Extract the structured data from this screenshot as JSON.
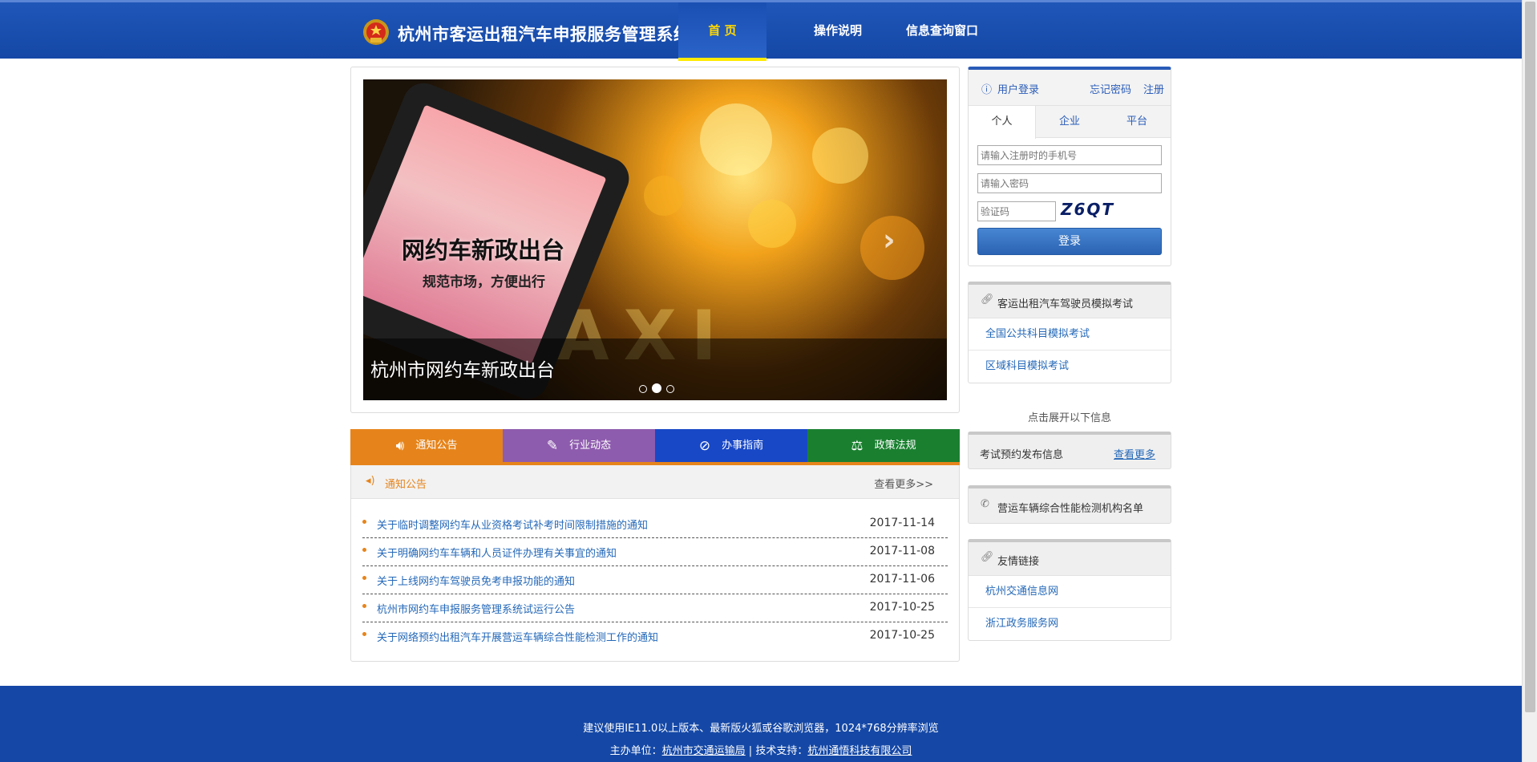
{
  "header": {
    "title": "杭州市客运出租汽车申报服务管理系统",
    "nav": [
      {
        "label": "首 页",
        "active": true
      },
      {
        "label": "操作说明",
        "active": false
      },
      {
        "label": "信息查询窗口",
        "active": false
      }
    ]
  },
  "slider": {
    "promo_title": "网约车新政出台",
    "promo_subtitle": "规范市场，方便出行",
    "sign_text": "TAXI",
    "caption": "杭州市网约车新政出台",
    "slide_count": 3,
    "active_slide": 2,
    "next_arrow": "›"
  },
  "news": {
    "tabs": [
      {
        "label": "通知公告",
        "icon": "speaker-icon",
        "color": "#e6841b"
      },
      {
        "label": "行业动态",
        "icon": "document-edit-icon",
        "color": "#8e5cae"
      },
      {
        "label": "办事指南",
        "icon": "compass-icon",
        "color": "#1848c6"
      },
      {
        "label": "政策法规",
        "icon": "scales-icon",
        "color": "#1a8030"
      }
    ],
    "section_title": "通知公告",
    "more_label": "查看更多>>",
    "items": [
      {
        "title": "关于临时调整网约车从业资格考试补考时间限制措施的通知",
        "date": "2017-11-14"
      },
      {
        "title": "关于明确网约车车辆和人员证件办理有关事宜的通知",
        "date": "2017-11-08"
      },
      {
        "title": "关于上线网约车驾驶员免考申报功能的通知",
        "date": "2017-11-06"
      },
      {
        "title": "杭州市网约车申报服务管理系统试运行公告",
        "date": "2017-10-25"
      },
      {
        "title": "关于网络预约出租汽车开展营运车辆综合性能检测工作的通知",
        "date": "2017-10-25"
      }
    ]
  },
  "login": {
    "title": "用户登录",
    "forgot_label": "忘记密码",
    "register_label": "注册",
    "tabs": [
      "个人",
      "企业",
      "平台"
    ],
    "active_tab": "个人",
    "phone_placeholder": "请输入注册时的手机号",
    "password_placeholder": "请输入密码",
    "captcha_placeholder": "验证码",
    "captcha_text": "Z6QT",
    "submit_label": "登录"
  },
  "mock_exam": {
    "title": "客运出租汽车驾驶员模拟考试",
    "links": [
      "全国公共科目模拟考试",
      "区域科目模拟考试"
    ]
  },
  "expand_hint": "点击展开以下信息",
  "exam_booking": {
    "title": "考试预约发布信息",
    "more_label": "查看更多"
  },
  "inspection": {
    "title": "营运车辆综合性能检测机构名单"
  },
  "friend_links": {
    "title": "友情链接",
    "links": [
      "杭州交通信息网",
      "浙江政务服务网"
    ]
  },
  "footer": {
    "browser_note": "建议使用IE11.0以上版本、最新版火狐或谷歌浏览器，1024*768分辨率浏览",
    "host_prefix": "主办单位：",
    "host": "杭州市交通运输局",
    "separator": " | 技术支持：",
    "tech": "杭州通悟科技有限公司"
  },
  "colors": {
    "header_blue": "#1548a6",
    "nav_active": "#ffd800",
    "accent_orange": "#e6841b",
    "link_blue": "#2468b8"
  }
}
